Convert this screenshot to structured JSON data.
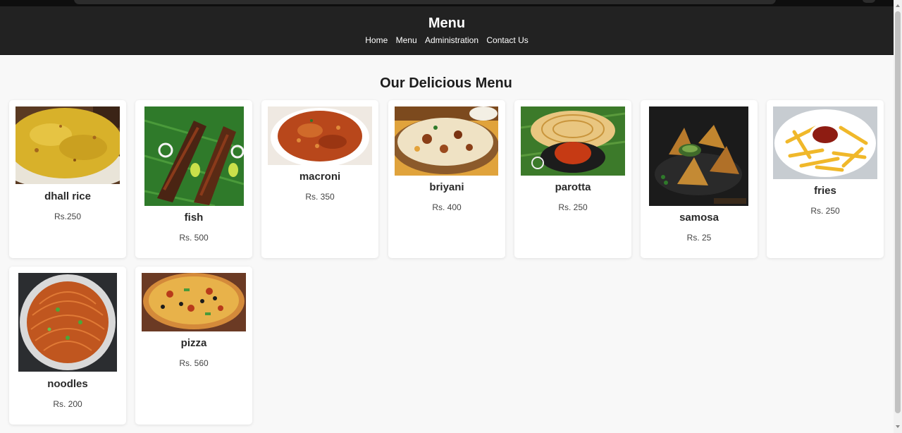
{
  "header": {
    "title": "Menu",
    "nav": [
      "Home",
      "Menu",
      "Administration",
      "Contact Us"
    ]
  },
  "main": {
    "heading": "Our Delicious Menu",
    "items": [
      {
        "name": "dhall rice",
        "price": "Rs.250",
        "icon": "dhall-rice-image"
      },
      {
        "name": "fish",
        "price": "Rs. 500",
        "icon": "fish-image"
      },
      {
        "name": "macroni",
        "price": "Rs. 350",
        "icon": "macaroni-image"
      },
      {
        "name": "briyani",
        "price": "Rs. 400",
        "icon": "biryani-image"
      },
      {
        "name": "parotta",
        "price": "Rs. 250",
        "icon": "parotta-image"
      },
      {
        "name": "samosa",
        "price": "Rs. 25",
        "icon": "samosa-image"
      },
      {
        "name": "fries",
        "price": "Rs. 250",
        "icon": "fries-image"
      },
      {
        "name": "noodles",
        "price": "Rs. 200",
        "icon": "noodles-image"
      },
      {
        "name": "pizza",
        "price": "Rs. 560",
        "icon": "pizza-image"
      }
    ]
  },
  "colors": {
    "header_bg": "#222222",
    "page_bg": "#f8f8f8",
    "card_bg": "#ffffff"
  }
}
